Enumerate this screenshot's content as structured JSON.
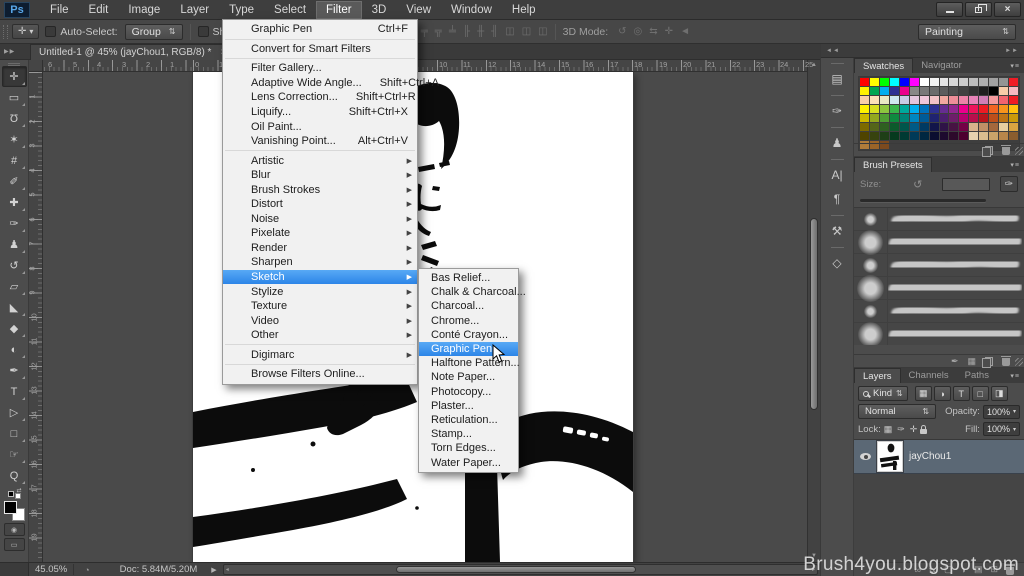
{
  "menu_bar": {
    "logo": "Ps",
    "items": [
      "File",
      "Edit",
      "Image",
      "Layer",
      "Type",
      "Select",
      "Filter",
      "3D",
      "View",
      "Window",
      "Help"
    ],
    "active_item": "Filter"
  },
  "window_controls": {
    "close_glyph": "×"
  },
  "options_bar": {
    "tool_glyph": "✛",
    "auto_select_label": "Auto-Select:",
    "group_value": "Group",
    "show_transform_label": "Show Tran",
    "align_icons": [
      "╤",
      "╦",
      "╧",
      "╟",
      "╫",
      "╢",
      "◫",
      "◫",
      "◫"
    ],
    "mode_label": "3D Mode:",
    "mode_icons": [
      "↺",
      "◎",
      "⇆",
      "✛",
      "◄"
    ],
    "workspace_value": "Painting"
  },
  "document_tab": {
    "title": "Untitled-1 @ 45% (jayChou1, RGB/8) *",
    "close": "×"
  },
  "filter_menu": {
    "items": [
      {
        "label": "Graphic Pen",
        "shortcut": "Ctrl+F"
      },
      {
        "separator": true
      },
      {
        "label": "Convert for Smart Filters"
      },
      {
        "separator": true
      },
      {
        "label": "Filter Gallery..."
      },
      {
        "label": "Adaptive Wide Angle...",
        "shortcut": "Shift+Ctrl+A"
      },
      {
        "label": "Lens Correction...",
        "shortcut": "Shift+Ctrl+R"
      },
      {
        "label": "Liquify...",
        "shortcut": "Shift+Ctrl+X"
      },
      {
        "label": "Oil Paint..."
      },
      {
        "label": "Vanishing Point...",
        "shortcut": "Alt+Ctrl+V"
      },
      {
        "separator": true
      },
      {
        "label": "Artistic",
        "submenu": true
      },
      {
        "label": "Blur",
        "submenu": true
      },
      {
        "label": "Brush Strokes",
        "submenu": true
      },
      {
        "label": "Distort",
        "submenu": true
      },
      {
        "label": "Noise",
        "submenu": true
      },
      {
        "label": "Pixelate",
        "submenu": true
      },
      {
        "label": "Render",
        "submenu": true
      },
      {
        "label": "Sharpen",
        "submenu": true
      },
      {
        "label": "Sketch",
        "submenu": true,
        "highlight": true
      },
      {
        "label": "Stylize",
        "submenu": true
      },
      {
        "label": "Texture",
        "submenu": true
      },
      {
        "label": "Video",
        "submenu": true
      },
      {
        "label": "Other",
        "submenu": true
      },
      {
        "separator": true
      },
      {
        "label": "Digimarc",
        "submenu": true
      },
      {
        "separator": true
      },
      {
        "label": "Browse Filters Online..."
      }
    ]
  },
  "sketch_submenu": {
    "highlighted_index": 5,
    "items": [
      "Bas Relief...",
      "Chalk & Charcoal...",
      "Charcoal...",
      "Chrome...",
      "Conté Crayon...",
      "Graphic Pen...",
      "Halftone Pattern...",
      "Note Paper...",
      "Photocopy...",
      "Plaster...",
      "Reticulation...",
      "Stamp...",
      "Torn Edges...",
      "Water Paper..."
    ]
  },
  "toolbar": {
    "tools": [
      {
        "name": "move",
        "glyph": "✛"
      },
      {
        "name": "rectangular-marquee",
        "glyph": "▭"
      },
      {
        "name": "lasso",
        "glyph": "Ʊ"
      },
      {
        "name": "quick-selection",
        "glyph": "✶"
      },
      {
        "name": "crop",
        "glyph": "#"
      },
      {
        "name": "eyedropper",
        "glyph": "✐"
      },
      {
        "name": "spot-healing-brush",
        "glyph": "✚"
      },
      {
        "name": "brush",
        "glyph": "✑"
      },
      {
        "name": "clone-stamp",
        "glyph": "♟"
      },
      {
        "name": "history-brush",
        "glyph": "↺"
      },
      {
        "name": "eraser",
        "glyph": "▱"
      },
      {
        "name": "paint-bucket",
        "glyph": "◣"
      },
      {
        "name": "blur",
        "glyph": "◆"
      },
      {
        "name": "dodge",
        "glyph": "◐"
      },
      {
        "name": "pen",
        "glyph": "✒"
      },
      {
        "name": "type",
        "glyph": "T"
      },
      {
        "name": "path-selection",
        "glyph": "▷"
      },
      {
        "name": "rectangle",
        "glyph": "□"
      },
      {
        "name": "hand",
        "glyph": "☞"
      },
      {
        "name": "zoom",
        "glyph": "Q"
      }
    ]
  },
  "rulers": {
    "top_numbers": [
      [
        3,
        "6"
      ],
      [
        28,
        "5"
      ],
      [
        52,
        "4"
      ],
      [
        77,
        "3"
      ],
      [
        101,
        "2"
      ],
      [
        125,
        "1"
      ],
      [
        150,
        "0"
      ],
      [
        174,
        "1"
      ],
      [
        394,
        "10"
      ],
      [
        418,
        "11"
      ],
      [
        443,
        "12"
      ],
      [
        467,
        "13"
      ],
      [
        492,
        "14"
      ],
      [
        516,
        "15"
      ],
      [
        540,
        "16"
      ],
      [
        565,
        "17"
      ],
      [
        589,
        "18"
      ],
      [
        614,
        "19"
      ],
      [
        638,
        "20"
      ],
      [
        662,
        "21"
      ],
      [
        687,
        "22"
      ],
      [
        711,
        "23"
      ],
      [
        735,
        "24"
      ],
      [
        760,
        "25"
      ]
    ],
    "left_numbers": [
      [
        24,
        "1"
      ],
      [
        49,
        "2"
      ],
      [
        73,
        "3"
      ],
      [
        98,
        "4"
      ],
      [
        122,
        "5"
      ],
      [
        147,
        "6"
      ],
      [
        171,
        "7"
      ],
      [
        196,
        "8"
      ],
      [
        220,
        "9"
      ],
      [
        245,
        "10"
      ],
      [
        269,
        "11"
      ],
      [
        294,
        "12"
      ],
      [
        318,
        "13"
      ],
      [
        343,
        "14"
      ],
      [
        367,
        "15"
      ],
      [
        392,
        "16"
      ],
      [
        416,
        "17"
      ],
      [
        441,
        "18"
      ],
      [
        465,
        "19"
      ]
    ]
  },
  "dock": {
    "collapse_left": "◄◄",
    "collapse_right": "►►",
    "icon_groups": [
      [
        {
          "name": "history-panel",
          "glyph": "▤"
        }
      ],
      [
        {
          "name": "brush-panel",
          "glyph": "✑"
        }
      ],
      [
        {
          "name": "clone-source-panel",
          "glyph": "♟"
        }
      ],
      [
        {
          "name": "character-panel",
          "glyph": "A|"
        },
        {
          "name": "paragraph-panel",
          "glyph": "¶"
        }
      ],
      [
        {
          "name": "tool-presets-panel",
          "glyph": "⚒"
        }
      ],
      [
        {
          "name": "3d-panel",
          "glyph": "◇"
        }
      ]
    ]
  },
  "swatches_panel": {
    "tabs": [
      "Swatches",
      "Navigator"
    ],
    "active_tab": "Swatches",
    "colors": [
      "#ff0000",
      "#ffff00",
      "#00ff00",
      "#00ffff",
      "#0000ff",
      "#ff00ff",
      "#ffffff",
      "#f2f2f2",
      "#e5e5e5",
      "#d8d8d8",
      "#cbcbcb",
      "#bdbdbd",
      "#b0b0b0",
      "#a2a2a2",
      "#949494",
      "#ee1c25",
      "#fff200",
      "#00a651",
      "#00aeef",
      "#2e3192",
      "#ec008c",
      "#878787",
      "#797979",
      "#6b6b6b",
      "#5d5d5d",
      "#4f4f4f",
      "#414141",
      "#323232",
      "#1f1f1f",
      "#000000",
      "#f7cba9",
      "#f6b8c1",
      "#f9cfa7",
      "#fbe1b9",
      "#e9e9c5",
      "#cfe8ef",
      "#c9cce6",
      "#e3c5de",
      "#f0c7da",
      "#f3c3c7",
      "#f2a9a0",
      "#ef8e99",
      "#ee84a8",
      "#e883b8",
      "#d17eb6",
      "#f59a9d",
      "#f2636f",
      "#ed1c24",
      "#fff200",
      "#d7e021",
      "#8dc63f",
      "#39b54a",
      "#00a99d",
      "#00aeef",
      "#0072bc",
      "#2e3192",
      "#662d91",
      "#92278f",
      "#ec008c",
      "#ed145b",
      "#ed1c24",
      "#f26522",
      "#f7941d",
      "#ffc20e",
      "#cdb900",
      "#93a71f",
      "#4f9e33",
      "#0f8a40",
      "#008578",
      "#0086c0",
      "#005b97",
      "#1f2370",
      "#4b1f6f",
      "#6e1e6a",
      "#b80070",
      "#b80f4c",
      "#b8161d",
      "#bd4f1b",
      "#bd7416",
      "#c9990b",
      "#7c6a00",
      "#55651a",
      "#2f6021",
      "#0c5a2c",
      "#00564b",
      "#005a85",
      "#003a62",
      "#12154a",
      "#2f1347",
      "#471343",
      "#740046",
      "#d9b38c",
      "#c09066",
      "#a4683c",
      "#e8cfa0",
      "#d9a441",
      "#4f4400",
      "#37430f",
      "#1e3f17",
      "#063a1e",
      "#003a33",
      "#003a58",
      "#002741",
      "#0a0d30",
      "#1d0a2e",
      "#2d0a2b",
      "#4d002f",
      "#e6d2ae",
      "#d9bd8f",
      "#c9a369",
      "#b8864a",
      "#8a5d2e",
      "#b07c3a",
      "#9a6428",
      "#7c4a1e"
    ]
  },
  "brush_panel": {
    "title": "Brush Presets",
    "size_label": "Size:",
    "reset_glyph": "↺",
    "tip_glyph": "✑",
    "rows": [
      13,
      25,
      15,
      27,
      13,
      25
    ],
    "foot_icons": [
      "✒",
      "▦"
    ]
  },
  "layers_panel": {
    "tabs": [
      "Layers",
      "Channels",
      "Paths"
    ],
    "active_tab": "Layers",
    "filter_value": "Kind",
    "filter_icons": [
      "▦",
      "◑",
      "T",
      "□",
      "◨"
    ],
    "blend_mode": "Normal",
    "opacity_label": "Opacity:",
    "opacity_value": "100%",
    "lock_label": "Lock:",
    "lock_icons": [
      "▦",
      "✑",
      "✛"
    ],
    "fill_label": "Fill:",
    "fill_value": "100%",
    "layer": {
      "name": "jayChou1"
    },
    "foot_icons": [
      "∞",
      "fx",
      "▢",
      "◑",
      "▤",
      "⊞"
    ]
  },
  "status_bar": {
    "zoom": "45.05%",
    "icon": "◔",
    "doc_info": "Doc: 5.84M/5.20M",
    "play": "▶"
  },
  "watermark": "Brush4you.blogspot.com",
  "colors": {
    "menu_highlight": "#2c85e8",
    "selected_layer_row": "#5b6875",
    "ui_background": "#474747",
    "canvas_white": "#ffffff"
  }
}
